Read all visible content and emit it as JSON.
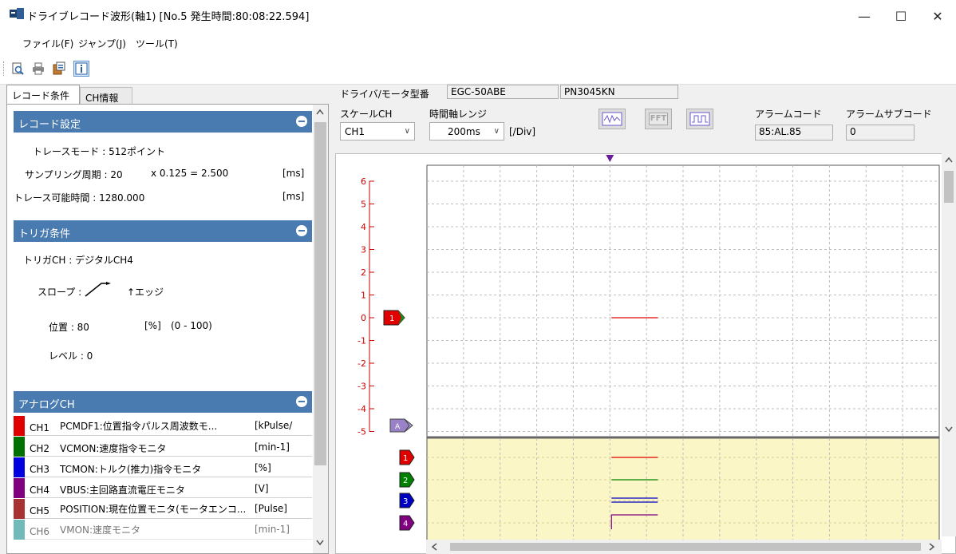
{
  "window": {
    "title": "ドライブレコード波形(軸1)  [No.5 発生時間:80:08:22.594]",
    "minimize": "—",
    "maximize": "☐",
    "close": "✕"
  },
  "menu": [
    "ファイル(F)",
    "ジャンプ(J)",
    "ツール(T)"
  ],
  "tabs": {
    "record": "レコード条件",
    "ch_info": "CH情報"
  },
  "record_settings": {
    "header": "レコード設定",
    "trace_mode": "トレースモード : 512ポイント",
    "sampling_label": "サンプリング周期 : 20",
    "sampling_calc": "x 0.125  = 2.500",
    "sampling_unit": "[ms]",
    "trace_time": "トレース可能時間 : 1280.000",
    "trace_time_unit": "[ms]"
  },
  "trigger": {
    "header": "トリガ条件",
    "trigger_ch": "トリガCH : デジタルCH4",
    "slope_label": "スロープ :",
    "slope_value": "↑エッジ",
    "position_label": "位置 : 80",
    "position_unit": "[%]",
    "position_range": "(0 - 100)",
    "level": "レベル : 0"
  },
  "analog": {
    "header": "アナログCH",
    "channels": [
      {
        "name": "CH1",
        "desc": "PCMDF1:位置指令パルス周波数モ...",
        "unit": "[kPulse/",
        "color": "#e00000"
      },
      {
        "name": "CH2",
        "desc": "VCMON:速度指令モニタ",
        "unit": "[min-1]",
        "color": "#007000"
      },
      {
        "name": "CH3",
        "desc": "TCMON:トルク(推力)指令モニタ",
        "unit": "[%]",
        "color": "#0000e0"
      },
      {
        "name": "CH4",
        "desc": "VBUS:主回路直流電圧モニタ",
        "unit": "[V]",
        "color": "#800080"
      },
      {
        "name": "CH5",
        "desc": "POSITION:現在位置モニタ(モータエンコ...",
        "unit": "[Pulse]",
        "color": "#a83232"
      },
      {
        "name": "CH6",
        "desc": "VMON:速度モニタ",
        "unit": "[min-1]",
        "color": "#008080"
      }
    ]
  },
  "model": {
    "label": "ドライバ/モータ型番",
    "driver": "EGC-50ABE",
    "motor": "PN3045KN"
  },
  "controls": {
    "scale_ch_label": "スケールCH",
    "scale_ch_value": "CH1",
    "time_range_label": "時間軸レンジ",
    "time_range_value": "200ms",
    "time_unit": "[/Div]",
    "fft_label": "FFT",
    "alarm_code_label": "アラームコード",
    "alarm_code_value": "85:AL.85",
    "alarm_sub_label": "アラームサブコード",
    "alarm_sub_value": "0"
  },
  "chart": {
    "y_ticks": [
      "6",
      "5",
      "4",
      "3",
      "2",
      "1",
      "0",
      "-1",
      "-2",
      "-3",
      "-4",
      "-5"
    ],
    "analog_marker": "1",
    "digital_markers": [
      "1",
      "2",
      "3",
      "4"
    ],
    "group_marker": "A",
    "colors": {
      "ch1": "#e00000",
      "ch2": "#008000",
      "ch3": "#0000c0",
      "ch4": "#800080",
      "digital_bg": "#fbf6c6",
      "trigger": "#6a1b9a"
    }
  }
}
